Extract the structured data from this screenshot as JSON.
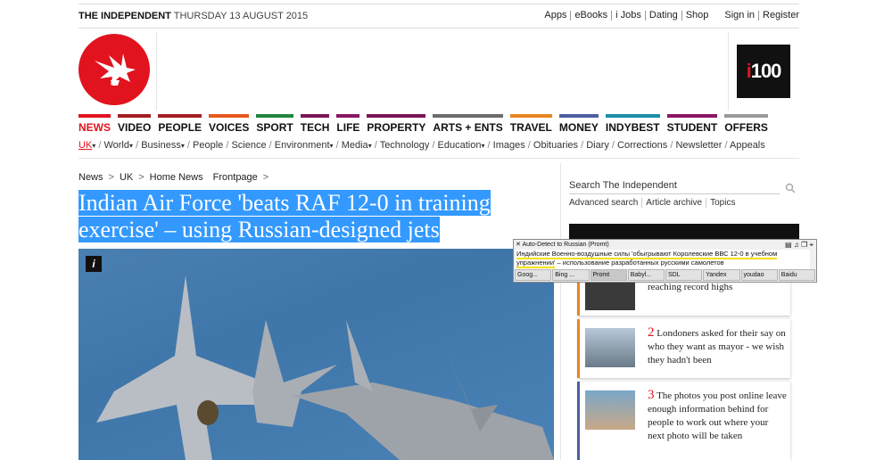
{
  "header": {
    "brand": "THE INDEPENDENT",
    "date": "THURSDAY 13 AUGUST 2015",
    "links": [
      "Apps",
      "eBooks",
      "i Jobs",
      "Dating",
      "Shop"
    ],
    "account": [
      "Sign in",
      "Register"
    ],
    "i100": "i100"
  },
  "nav": {
    "items": [
      {
        "label": "NEWS",
        "color": "#e1131e"
      },
      {
        "label": "VIDEO",
        "color": "#a41e23"
      },
      {
        "label": "PEOPLE",
        "color": "#a41e23"
      },
      {
        "label": "VOICES",
        "color": "#e8581f"
      },
      {
        "label": "SPORT",
        "color": "#23853d"
      },
      {
        "label": "TECH",
        "color": "#7a1457"
      },
      {
        "label": "LIFE",
        "color": "#8a1565"
      },
      {
        "label": "PROPERTY",
        "color": "#7a1457"
      },
      {
        "label": "ARTS + ENTS",
        "color": "#6b6b6b"
      },
      {
        "label": "TRAVEL",
        "color": "#e8851f"
      },
      {
        "label": "MONEY",
        "color": "#4d5fa0"
      },
      {
        "label": "INDYBEST",
        "color": "#1b8fa8"
      },
      {
        "label": "STUDENT",
        "color": "#8a1565"
      },
      {
        "label": "OFFERS",
        "color": "#9a9a9a"
      }
    ],
    "sub": [
      "UK",
      "World",
      "Business",
      "People",
      "Science",
      "Environment",
      "Media",
      "Technology",
      "Education",
      "Images",
      "Obituaries",
      "Diary",
      "Corrections",
      "Newsletter",
      "Appeals"
    ]
  },
  "breadcrumb": [
    "News",
    "UK",
    "Home News",
    "Frontpage"
  ],
  "article": {
    "headline_line1": "Indian Air Force 'beats RAF 12-0 in training",
    "headline_line2": "exercise' – using Russian-designed jets",
    "info_icon": "i"
  },
  "sidebar": {
    "search_label": "Search The Independent",
    "links": [
      "Advanced search",
      "Article archive",
      "Topics"
    ],
    "cards": [
      {
        "num": "",
        "text": "reaching record highs"
      },
      {
        "num": "2",
        "text": "Londoners asked for their say on who they want as mayor - we wish they hadn't been"
      },
      {
        "num": "3",
        "text": "The photos you post online leave enough information behind for people to work out where your next photo will be taken"
      }
    ]
  },
  "translator": {
    "title": "Auto-Detect to Russian (Promt)",
    "text_line1": "Индийские Военно-воздушные силы 'обыгрывают Королевские ВВС 12-0 в учебном",
    "text_line2": "упражнении'",
    "text_line2b": " – использование разработанных русскими самолетов",
    "tabs": [
      "Goog...",
      "Bing ...",
      "Promt",
      "Babyl...",
      "SDL",
      "Yandex",
      "youdao",
      "Baidu"
    ]
  }
}
